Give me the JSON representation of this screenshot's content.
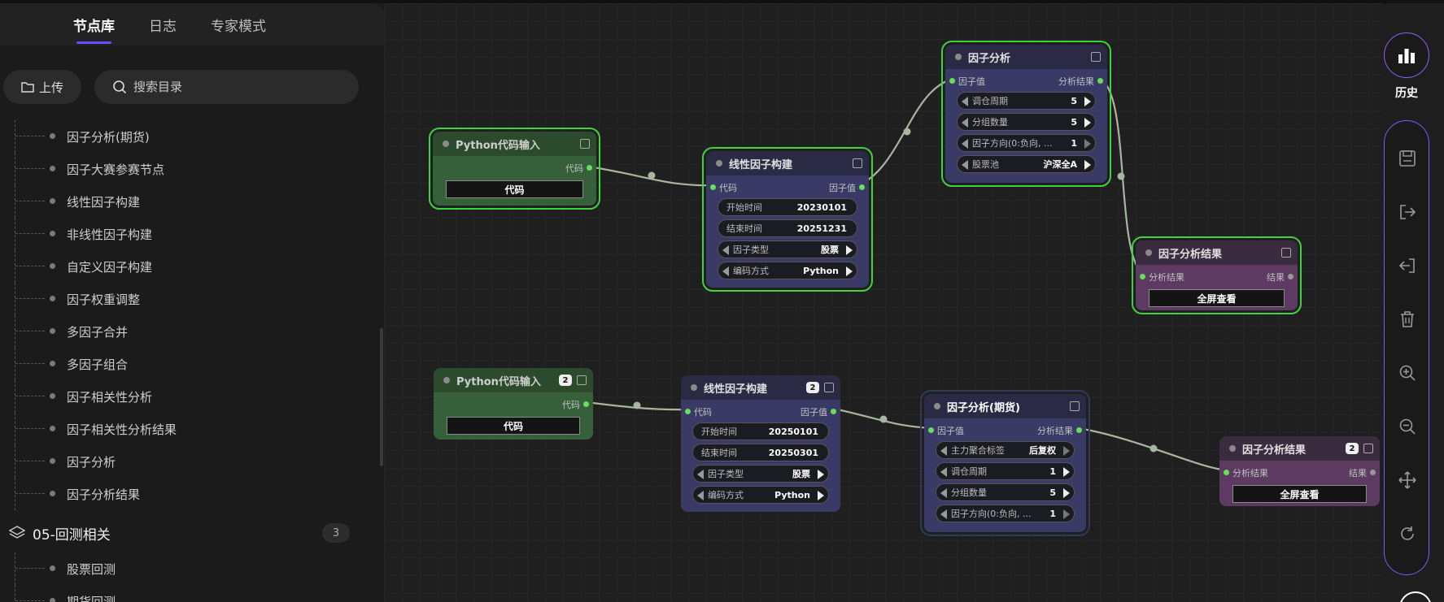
{
  "tabs": [
    {
      "label": "节点库",
      "active": true
    },
    {
      "label": "日志",
      "active": false
    },
    {
      "label": "专家模式",
      "active": false
    }
  ],
  "toolbar": {
    "upload_label": "上传",
    "search_placeholder": "搜索目录"
  },
  "tree_items": [
    "因子分析(期货)",
    "因子大赛参赛节点",
    "线性因子构建",
    "非线性因子构建",
    "自定义因子构建",
    "因子权重调整",
    "多因子合并",
    "多因子组合",
    "因子相关性分析",
    "因子相关性分析结果",
    "因子分析",
    "因子分析结果"
  ],
  "group": {
    "label": "05-回测相关",
    "count": "3"
  },
  "tree_items_2": [
    "股票回测",
    "期货回测"
  ],
  "nodes": {
    "py1": {
      "title": "Python代码输入",
      "out": "代码",
      "button": "代码"
    },
    "lin1": {
      "title": "线性因子构建",
      "in": "代码",
      "out": "因子值",
      "f1_label": "开始时间",
      "f1_value": "20230101",
      "f2_label": "结束时间",
      "f2_value": "20251231",
      "f3_label": "因子类型",
      "f3_value": "股票",
      "f4_label": "编码方式",
      "f4_value": "Python"
    },
    "fa1": {
      "title": "因子分析",
      "in": "因子值",
      "out": "分析结果",
      "f1_label": "调仓周期",
      "f1_value": "5",
      "f2_label": "分组数量",
      "f2_value": "5",
      "f3_label": "因子方向(0:负向, ...",
      "f3_value": "1",
      "f4_label": "股票池",
      "f4_value": "沪深全A"
    },
    "far1": {
      "title": "因子分析结果",
      "in": "分析结果",
      "out": "结果",
      "button": "全屏查看"
    },
    "py2": {
      "title": "Python代码输入",
      "badge": "2",
      "out": "代码",
      "button": "代码"
    },
    "lin2": {
      "title": "线性因子构建",
      "badge": "2",
      "in": "代码",
      "out": "因子值",
      "f1_label": "开始时间",
      "f1_value": "20250101",
      "f2_label": "结束时间",
      "f2_value": "20250301",
      "f3_label": "因子类型",
      "f3_value": "股票",
      "f4_label": "编码方式",
      "f4_value": "Python"
    },
    "fa2": {
      "title": "因子分析(期货)",
      "in": "因子值",
      "out": "分析结果",
      "f1_label": "主力聚合标签",
      "f1_value": "后复权",
      "f2_label": "调仓周期",
      "f2_value": "1",
      "f3_label": "分组数量",
      "f3_value": "5",
      "f4_label": "因子方向(0:负向, ...",
      "f4_value": "1"
    },
    "far2": {
      "title": "因子分析结果",
      "badge": "2",
      "in": "分析结果",
      "out": "结果",
      "button": "全屏查看"
    }
  },
  "right_toolbar": {
    "history_label": "历史",
    "icons": [
      "save-icon",
      "export-icon",
      "import-icon",
      "trash-icon",
      "zoom-in-icon",
      "zoom-out-icon",
      "move-icon",
      "refresh-icon"
    ]
  },
  "colors": {
    "accent": "#6b4dff",
    "selected_outline": "#3fd33f",
    "wire": "#a8b5a0",
    "port": "#66e05a"
  }
}
